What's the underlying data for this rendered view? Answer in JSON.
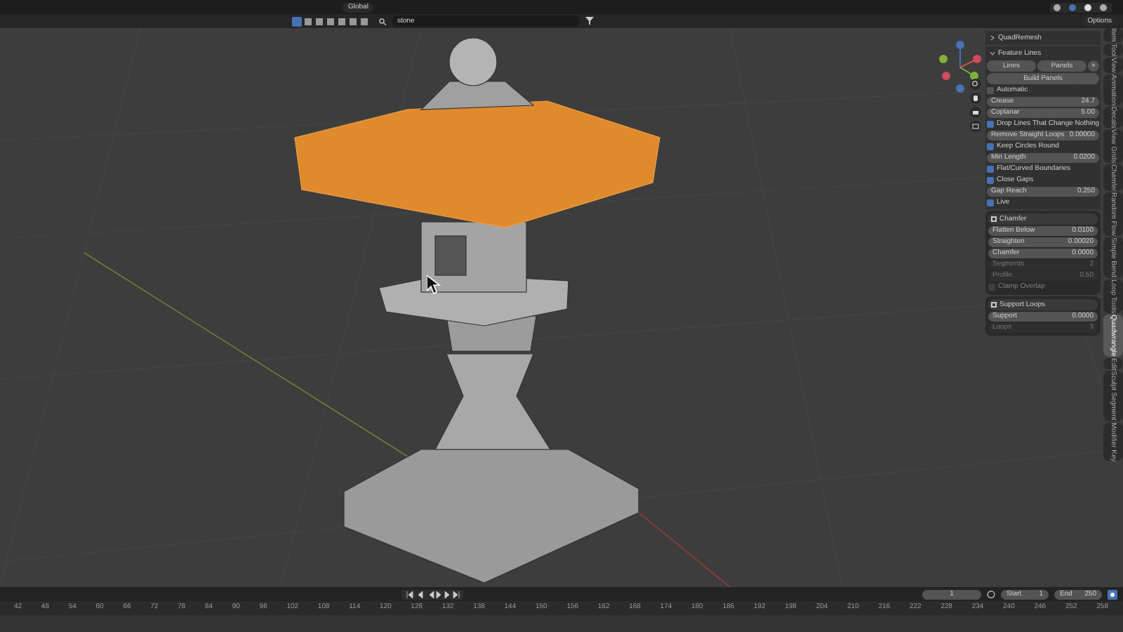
{
  "header": {
    "orientation": "Global",
    "search": {
      "value": "stone"
    },
    "options": "Options"
  },
  "panel_groups": [
    {
      "title": "QuadRemesh",
      "expanded": false,
      "boxed": false
    },
    {
      "title": "Feature Lines",
      "expanded": true,
      "boxed": false,
      "items": [
        {
          "kind": "button_row",
          "labels": [
            "Lines",
            "Panels"
          ],
          "close": "×"
        },
        {
          "kind": "button",
          "label": "Build Panels"
        },
        {
          "kind": "checkbox",
          "label": "Automatic",
          "checked": false,
          "disabled": false
        },
        {
          "kind": "field",
          "label": "Crease",
          "value": "24.7",
          "disabled": false
        },
        {
          "kind": "field",
          "label": "Coplanar",
          "value": "5.00",
          "disabled": false
        },
        {
          "kind": "checkbox",
          "label": "Drop Lines That Change Nothing",
          "checked": true,
          "disabled": false
        },
        {
          "kind": "field",
          "label": "Remove Straight Loops",
          "value": "0.00000",
          "disabled": false
        },
        {
          "kind": "checkbox",
          "label": "Keep Circles Round",
          "checked": true,
          "disabled": false
        },
        {
          "kind": "field",
          "label": "Min Length",
          "value": "0.0200",
          "disabled": false
        },
        {
          "kind": "checkbox",
          "label": "Flat/Curved Boundaries",
          "checked": true,
          "disabled": false
        },
        {
          "kind": "checkbox",
          "label": "Close Gaps",
          "checked": true,
          "disabled": false
        },
        {
          "kind": "field",
          "label": "Gap Reach",
          "value": "0.250",
          "disabled": false
        },
        {
          "kind": "checkbox",
          "label": "Live",
          "checked": true,
          "disabled": false
        }
      ]
    },
    {
      "title": "Chamfer",
      "expanded": true,
      "boxed": true,
      "items": [
        {
          "kind": "field",
          "label": "Flatten Below",
          "value": "0.0100",
          "disabled": false
        },
        {
          "kind": "field",
          "label": "Straighten",
          "value": "0.00020",
          "disabled": false
        },
        {
          "kind": "field",
          "label": "Chamfer",
          "value": "0.0000",
          "disabled": false
        },
        {
          "kind": "field",
          "label": "Segments",
          "value": "2",
          "disabled": true
        },
        {
          "kind": "field",
          "label": "Profile",
          "value": "0.50",
          "disabled": true
        },
        {
          "kind": "checkbox",
          "label": "Clamp Overlap",
          "checked": false,
          "disabled": true
        }
      ]
    },
    {
      "title": "Support Loops",
      "expanded": true,
      "boxed": true,
      "items": [
        {
          "kind": "field",
          "label": "Support",
          "value": "0.0000",
          "disabled": false
        },
        {
          "kind": "field",
          "label": "Loops",
          "value": "3",
          "disabled": true
        }
      ]
    }
  ],
  "side_tabs": [
    {
      "label": "Item",
      "selected": false
    },
    {
      "label": "Tool",
      "selected": false
    },
    {
      "label": "View",
      "selected": false
    },
    {
      "label": "Animation",
      "selected": false
    },
    {
      "label": "Decals",
      "selected": false
    },
    {
      "label": "View Grids",
      "selected": false
    },
    {
      "label": "Chamfer",
      "selected": false
    },
    {
      "label": "Random Flow",
      "selected": false
    },
    {
      "label": "Simple Bend",
      "selected": false
    },
    {
      "label": "Loop Tools",
      "selected": false
    },
    {
      "label": "Quadwrangle",
      "selected": true
    },
    {
      "label": "Edit",
      "selected": false
    },
    {
      "label": "Sculpt Segment",
      "selected": false
    },
    {
      "label": "Modifier Key",
      "selected": false
    }
  ],
  "timeline": {
    "frame": "1",
    "start_label": "Start",
    "start": "1",
    "end_label": "End",
    "end": "250",
    "ruler": [
      "42",
      "48",
      "54",
      "60",
      "66",
      "72",
      "78",
      "84",
      "90",
      "96",
      "102",
      "108",
      "114",
      "120",
      "126",
      "132",
      "138",
      "144",
      "150",
      "156",
      "162",
      "168",
      "174",
      "180",
      "186",
      "192",
      "198",
      "204",
      "210",
      "216",
      "222",
      "228",
      "234",
      "240",
      "246",
      "252",
      "258"
    ]
  }
}
